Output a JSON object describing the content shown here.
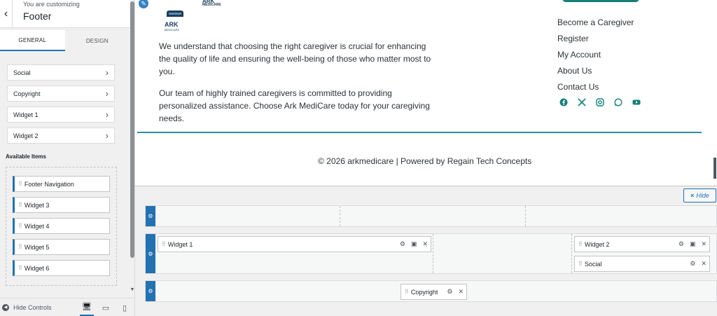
{
  "sidebar": {
    "back_icon": "‹",
    "customizing_label": "You are customizing",
    "title": "Footer",
    "tabs": [
      "GENERAL",
      "DESIGN"
    ],
    "sections": [
      "Social",
      "Copyright",
      "Widget 1",
      "Widget 2"
    ],
    "available_title": "Available Items",
    "available_items": [
      "Footer Navigation",
      "Widget 3",
      "Widget 4",
      "Widget 5",
      "Widget 6"
    ],
    "footer": {
      "hide_controls": "Hide Controls"
    }
  },
  "preview": {
    "logo": {
      "text": "ARK",
      "subtext": "MEDICARE"
    },
    "paragraphs": [
      "We understand that choosing the right caregiver is crucial for enhancing the quality of life and ensuring the well-being of those who matter most to you.",
      "Our team of highly trained caregivers is committed to providing personalized assistance. Choose Ark MediCare today for your caregiving needs."
    ],
    "nav_links": [
      "Become a Caregiver",
      "Register",
      "My Account",
      "About Us",
      "Contact Us"
    ],
    "socials": [
      "facebook-icon",
      "x-icon",
      "instagram-icon",
      "whatsapp-icon",
      "youtube-icon"
    ],
    "copyright": "© 2026 arkmedicare | Powered by Regain Tech Concepts",
    "accent_color": "#157f78"
  },
  "builder": {
    "hide_label": "Hide",
    "hide_icon": "×",
    "widgets": {
      "widget1": "Widget 1",
      "widget2": "Widget 2",
      "social": "Social",
      "copyright": "Copyright"
    }
  }
}
